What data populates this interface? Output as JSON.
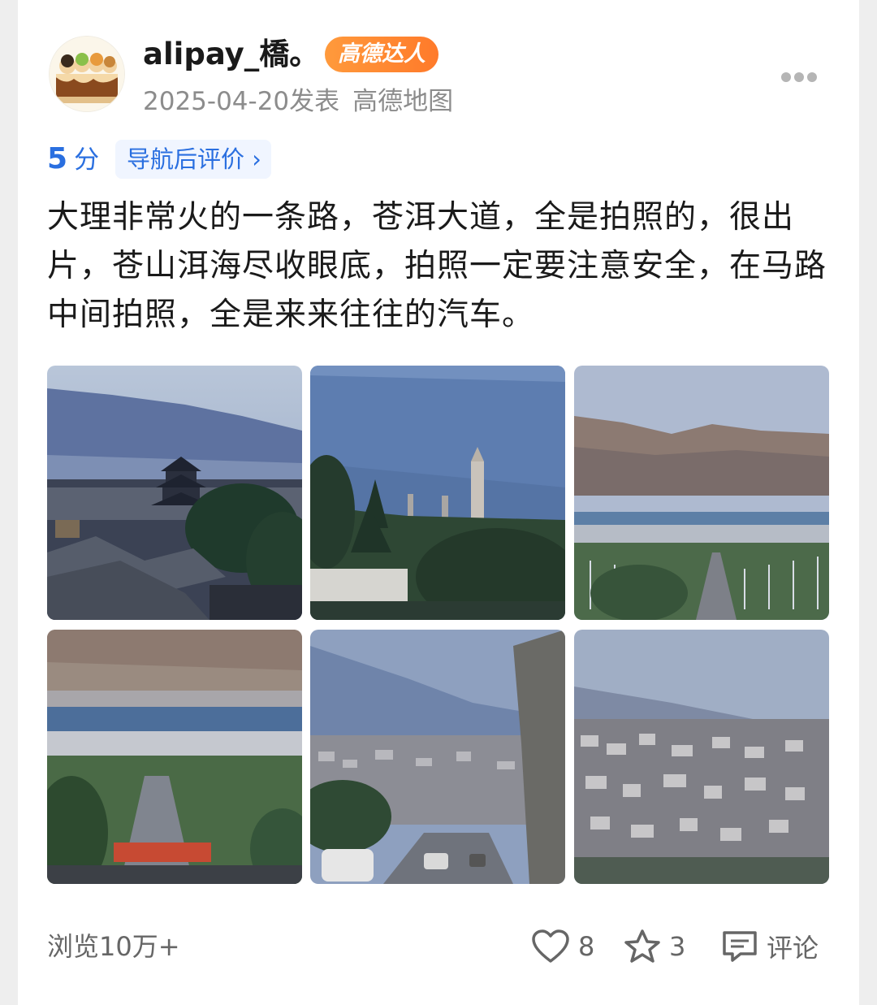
{
  "post": {
    "username": "alipay_橋。",
    "badge": "高德达人",
    "date": "2025-04-20发表",
    "source": "高德地图"
  },
  "rating": {
    "score": "5",
    "unit": "分",
    "nav_label": "导航后评价",
    "nav_chevron": "›"
  },
  "content": {
    "text": "大理非常火的一条路，苍洱大道，全是拍照的，很出片，苍山洱海尽收眼底，拍照一定要注意安全，在马路中间拍照，全是来来往往的汽车。"
  },
  "photos": [
    {
      "scene": "ancient-town-pavilion"
    },
    {
      "scene": "three-pagodas"
    },
    {
      "scene": "erhai-lake-avenue"
    },
    {
      "scene": "avenue-overlook"
    },
    {
      "scene": "street-with-cars"
    },
    {
      "scene": "hillside-village"
    }
  ],
  "footer": {
    "views": "浏览10万+",
    "likes": "8",
    "favorites": "3",
    "comment_label": "评论"
  },
  "icons": {
    "more": "more-dots-icon",
    "like": "heart-icon",
    "favorite": "star-icon",
    "comment": "comment-icon"
  },
  "colors": {
    "accent_blue": "#2a6fe0",
    "badge_orange": "#ff8a30",
    "text_primary": "#1a1a1a",
    "text_secondary": "#8c8c8c"
  }
}
